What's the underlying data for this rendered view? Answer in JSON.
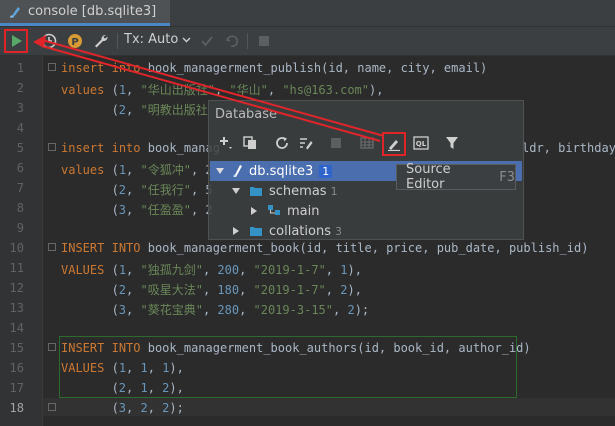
{
  "tab": {
    "label": "console [db.sqlite3]"
  },
  "toolbar": {
    "tx_label": "Tx: Auto"
  },
  "editor": {
    "line_numbers": [
      "1",
      "2",
      "3",
      "4",
      "5",
      "6",
      "7",
      "8",
      "9",
      "10",
      "11",
      "12",
      "13",
      "14",
      "15",
      "16",
      "17",
      "18"
    ],
    "lines": {
      "l1": [
        "insert",
        " ",
        "into",
        " book_managerment_publish(id, name, city, email)"
      ],
      "l2": [
        "values",
        " (",
        "1",
        ", ",
        "\"华山出版社\"",
        ", ",
        "\"华山\"",
        ", ",
        "\"hs@163.com\"",
        "),"
      ],
      "l3": [
        "       (",
        "2",
        ", ",
        "\"明教出版社"
      ],
      "l5": [
        "insert",
        " ",
        "into",
        " book_manag"
      ],
      "l5r": [
        "ldr, birthday)"
      ],
      "l6": [
        "values",
        " (",
        "1",
        ", ",
        "\"令狐冲\"",
        ", 2"
      ],
      "l7": [
        "       (",
        "2",
        ", ",
        "\"任我行\"",
        ", 5"
      ],
      "l8": [
        "       (",
        "3",
        ", ",
        "\"任盈盈\"",
        ", 2"
      ],
      "l10": [
        "INSERT",
        " ",
        "INTO",
        " book_managerment_book(id, title, price, pub_date, publish_id)"
      ],
      "l11": [
        "VALUES",
        " (",
        "1",
        ", ",
        "\"独孤九剑\"",
        ", ",
        "200",
        ", ",
        "\"2019-1-7\"",
        ", ",
        "1",
        "),"
      ],
      "l12": [
        "       (",
        "2",
        ", ",
        "\"吸星大法\"",
        ", ",
        "180",
        ", ",
        "\"2019-1-7\"",
        ", ",
        "2",
        "),"
      ],
      "l13": [
        "       (",
        "3",
        ", ",
        "\"葵花宝典\"",
        ", ",
        "280",
        ", ",
        "\"2019-3-15\"",
        ", ",
        "2",
        ");"
      ],
      "l15": [
        "INSERT",
        " ",
        "INTO",
        " book_managerment_book_authors(id, book_id, author_id)"
      ],
      "l16": [
        "VALUES",
        " (",
        "1",
        ", ",
        "1",
        ", ",
        "1",
        "),"
      ],
      "l17": [
        "       (",
        "2",
        ", ",
        "1",
        ", ",
        "2",
        "),"
      ],
      "l18": [
        "       (",
        "3",
        ", ",
        "2",
        ", ",
        "2",
        ");"
      ]
    }
  },
  "database_popup": {
    "title": "Database",
    "tree": {
      "db_name": "db.sqlite3",
      "db_badge": "1",
      "schemas_label": "schemas",
      "schemas_count": "1",
      "main_label": "main",
      "collations_label": "collations",
      "collations_count": "3"
    }
  },
  "tooltip": {
    "label": "Source Editor",
    "shortcut": "F3"
  },
  "colors": {
    "accent": "#4b6eaf",
    "highlight": "#e0252a",
    "run": "#59a869"
  }
}
